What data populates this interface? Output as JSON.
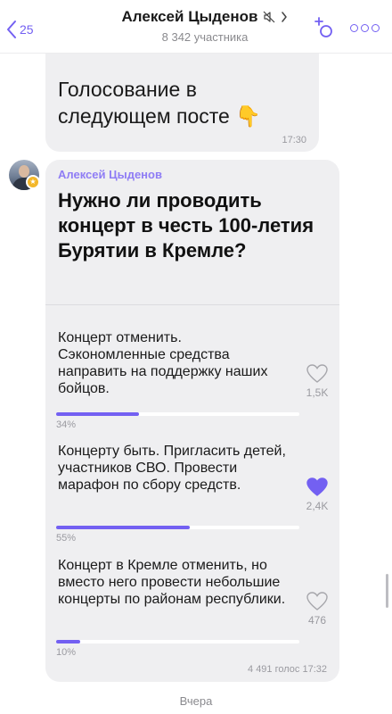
{
  "header": {
    "back_count": "25",
    "title": "Алексей Цыденов",
    "subtitle": "8 342 участника"
  },
  "message1": {
    "text_line1": "Голосование в",
    "text_line2": "следующем посте",
    "emoji": "👇",
    "time": "17:30"
  },
  "poll": {
    "sender": "Алексей Цыденов",
    "question": "Нужно ли проводить концерт в честь 100-летия Бурятии в Кремле?",
    "options": [
      {
        "text": "Концерт отменить. Сэкономленные средства направить на поддержку наших бойцов.",
        "votes": "1,5K",
        "percent_label": "34%",
        "percent": 34,
        "voted": false
      },
      {
        "text": "Концерту быть. Пригласить детей, участников СВО. Провести марафон по сбору средств.",
        "votes": "2,4K",
        "percent_label": "55%",
        "percent": 55,
        "voted": true
      },
      {
        "text": "Концерт в Кремле отменить, но вместо него провести небольшие концерты по районам республики.",
        "votes": "476",
        "percent_label": "10%",
        "percent": 10,
        "voted": false
      }
    ],
    "total_votes": "4 491 голос",
    "time": "17:32"
  },
  "date_label": "Вчера",
  "colors": {
    "accent": "#7360f2",
    "sender": "#8f7df5",
    "bubble": "#efeff1"
  }
}
